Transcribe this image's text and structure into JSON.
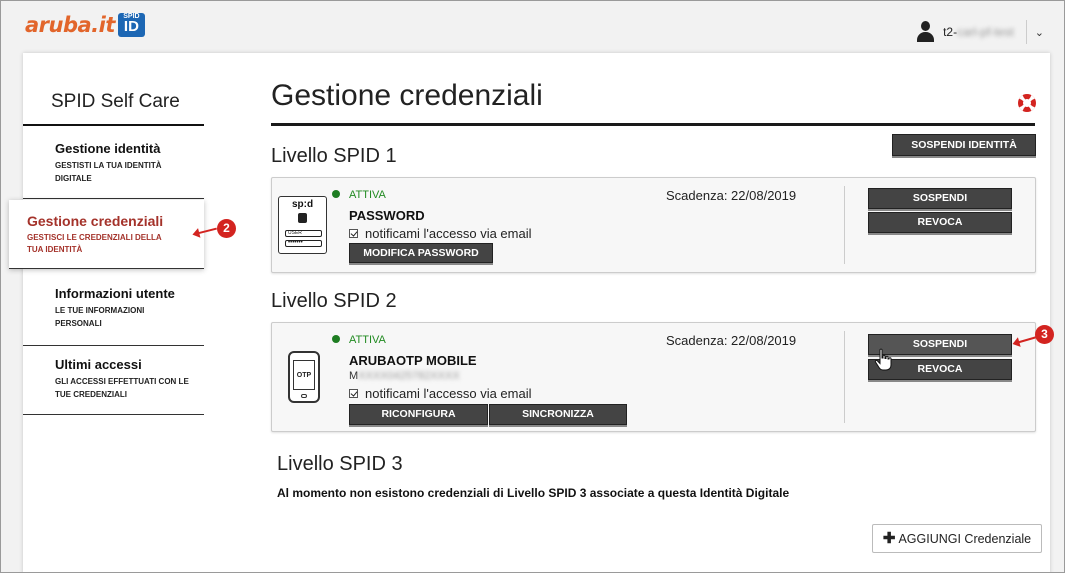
{
  "header": {
    "logo_text": "aruba.it",
    "logo_badge_top": "SPID",
    "logo_badge": "ID",
    "user_prefix": "t2-",
    "user_blurred": "carl-pf-test",
    "user_menu_icon": "chevron-down-icon"
  },
  "sidebar": {
    "title": "SPID Self Care",
    "items": [
      {
        "label": "Gestione identità",
        "sub": "GESTISTI LA TUA IDENTITÀ DIGITALE"
      },
      {
        "label": "Gestione credenziali",
        "sub": "GESTISCI LE CREDENZIALI DELLA TUA IDENTITÀ"
      },
      {
        "label": "Informazioni utente",
        "sub": "LE TUE INFORMAZIONI PERSONALI"
      },
      {
        "label": "Ultimi accessi",
        "sub": "GLI ACCESSI EFFETTUATI CON LE TUE CREDENZIALI"
      }
    ],
    "active_index": 1
  },
  "markers": {
    "m2": "2",
    "m3": "3"
  },
  "main": {
    "title": "Gestione credenziali",
    "suspend_identity": "SOSPENDI IDENTITÀ",
    "level1": {
      "title": "Livello SPID 1",
      "status": "ATTIVA",
      "name": "PASSWORD",
      "notify": "notificami l'accesso via email",
      "modify": "MODIFICA PASSWORD",
      "expiry": "Scadenza: 22/08/2019",
      "suspend": "SOSPENDI",
      "revoke": "REVOCA",
      "icon_label": "sp:d",
      "icon_field_1": "USER",
      "icon_field_2": "•••••••"
    },
    "level2": {
      "title": "Livello SPID 2",
      "status": "ATTIVA",
      "name": "ARUBAOTP MOBILE",
      "number_prefix": "M",
      "number_blurred": "XXXX0425782XXXX",
      "notify": "notificami l'accesso via email",
      "reconfigure": "RICONFIGURA",
      "sync": "SINCRONIZZA",
      "expiry": "Scadenza: 22/08/2019",
      "suspend": "SOSPENDI",
      "revoke": "REVOCA",
      "icon_label": "OTP"
    },
    "level3": {
      "title": "Livello SPID 3",
      "text": "Al momento non esistono credenziali di Livello SPID 3 associate a questa Identità Digitale"
    },
    "add_button": "AGGIUNGI Credenziale"
  },
  "colors": {
    "accent_red": "#d32420",
    "active_text": "#a4322a",
    "status_green": "#1e7d22",
    "button": "#444444"
  }
}
